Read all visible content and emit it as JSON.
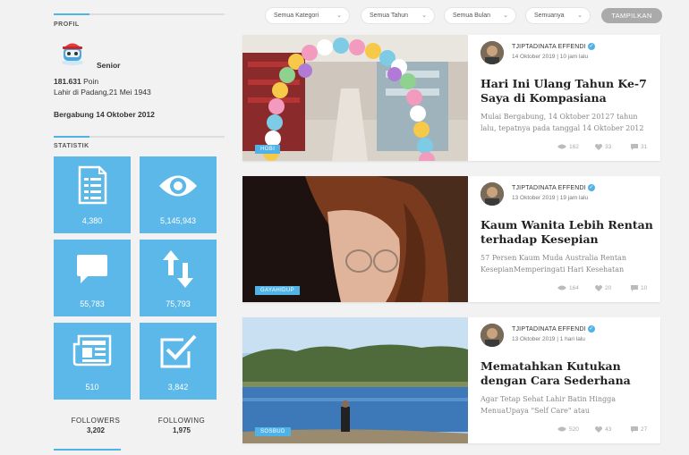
{
  "filters": {
    "kategori": "Semua Kategori",
    "tahun": "Semua Tahun",
    "bulan": "Semua Bulan",
    "jenis": "Semuanya",
    "submit": "TAMPILKAN"
  },
  "profile": {
    "section_title": "PROFIL",
    "level": "Senior",
    "points_value": "181.631",
    "points_label": "Poin",
    "birth": "Lahir di Padang,21 Mei 1943",
    "joined": "Bergabung 14 Oktober 2012"
  },
  "stats": {
    "section_title": "STATISTIK",
    "items": [
      {
        "icon": "document-icon",
        "value": "4,380"
      },
      {
        "icon": "eye-icon",
        "value": "5,145,943"
      },
      {
        "icon": "comment-icon",
        "value": "55,783"
      },
      {
        "icon": "arrows-updown-icon",
        "value": "75,793"
      },
      {
        "icon": "newspaper-icon",
        "value": "510"
      },
      {
        "icon": "checkbox-icon",
        "value": "3,842"
      }
    ],
    "followers_label": "FOLLOWERS",
    "followers_value": "3,202",
    "following_label": "FOLLOWING",
    "following_value": "1,975"
  },
  "articles": [
    {
      "category": "HOBI",
      "author": "TJIPTADINATA EFFENDI",
      "date": "14 Oktober 2019 | 10 jam lalu",
      "title": "Hari Ini Ulang Tahun Ke-7 Saya di Kompasiana",
      "excerpt": "Mulai Bergabung, 14 Oktober 20127 tahun lalu, tepatnya pada tanggal 14 Oktober 2012",
      "views": "162",
      "likes": "33",
      "comments": "31"
    },
    {
      "category": "GAYAHIDUP",
      "author": "TJIPTADINATA EFFENDI",
      "date": "13 Oktober 2019 | 19 jam lalu",
      "title": "Kaum Wanita Lebih Rentan terhadap Kesepian",
      "excerpt": "57 Persen Kaum Muda Australia Rentan KesepianMemperingati Hari Kesehatan",
      "views": "164",
      "likes": "20",
      "comments": "10"
    },
    {
      "category": "SOSBUD",
      "author": "TJIPTADINATA EFFENDI",
      "date": "13 Oktober 2019 | 1 hari lalu",
      "title": "Mematahkan Kutukan dengan Cara Sederhana",
      "excerpt": "Agar Tetap Sehat Lahir Batin Hingga MenuaUpaya \"Self Care\" atau",
      "views": "520",
      "likes": "43",
      "comments": "27"
    }
  ],
  "colors": {
    "accent": "#4fb3e8",
    "stat_tile": "#5cb8e8",
    "button_gray": "#aaaaaa"
  }
}
